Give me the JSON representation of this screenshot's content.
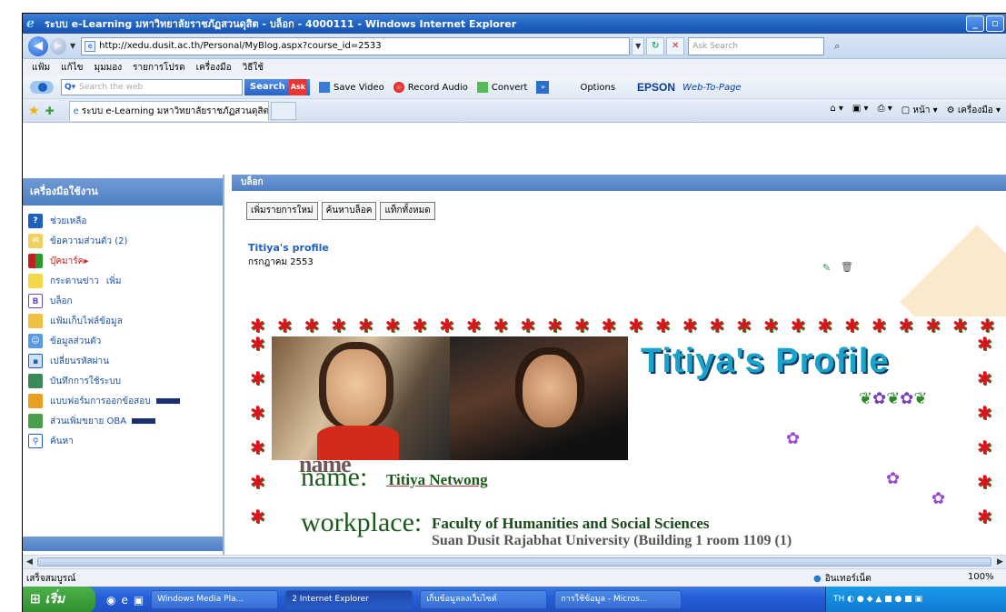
{
  "window": {
    "title": "ระบบ e-Learning มหาวิทยาลัยราชภัฏสวนดุสิต - บล็อก - 4000111 - Windows Internet Explorer"
  },
  "address": {
    "url": "http://xedu.dusit.ac.th/Personal/MyBlog.aspx?course_id=2533",
    "search_placeholder": "Ask Search"
  },
  "menu": {
    "items": [
      "แฟ้ม",
      "แก้ไข",
      "มุมมอง",
      "รายการโปรด",
      "เครื่องมือ",
      "วิธีใช้"
    ]
  },
  "toolbar": {
    "search_placeholder": "Search the web",
    "search_label": "Search",
    "ask_badge": "Ask",
    "save_video": "Save Video",
    "record_audio": "Record Audio",
    "convert": "Convert",
    "options": "Options",
    "epson": "EPSON",
    "web_to_page": "Web-To-Page"
  },
  "tabs": {
    "active_label": "ระบบ e-Learning มหาวิทยาลัยราชภัฏสวนดุสิต - บล็อก - ...",
    "home_label": "หน้า",
    "tools_label": "เครื่องมือ"
  },
  "sidebar": {
    "title": "เครื่องมือใช้งาน",
    "items": [
      {
        "label": "ช่วยเหลือ",
        "icon": "help-icon"
      },
      {
        "label": "ข้อความส่วนตัว (2)",
        "icon": "mail-icon"
      },
      {
        "label": "บุ๊คมาร์ค",
        "icon": "bookmark-icon"
      },
      {
        "label": "กระดานข่าว",
        "extra": "เพิ่ม",
        "icon": "board-icon"
      },
      {
        "label": "บล็อก",
        "icon": "blog-icon"
      },
      {
        "label": "แฟ้มเก็บไฟล์ข้อมูล",
        "icon": "folder-icon"
      },
      {
        "label": "ข้อมูลส่วนตัว",
        "icon": "profile-icon"
      },
      {
        "label": "เปลี่ยนรหัสผ่าน",
        "icon": "password-icon"
      },
      {
        "label": "บันทึกการใช้ระบบ",
        "icon": "log-icon"
      },
      {
        "label": "แบบฟอร์มการออกข้อสอบ",
        "icon": "form-icon"
      },
      {
        "label": "ส่วนเพิ่มขยาย OBA",
        "icon": "oba-icon"
      },
      {
        "label": "ค้นหา",
        "icon": "search-icon"
      }
    ]
  },
  "main": {
    "section_title": "บล็อก",
    "buttons": [
      "เพิ่มรายการใหม่",
      "ค้นหาบล็อค",
      "แท็กทั้งหมด"
    ],
    "post_title": "Titiya's profile",
    "post_date": "กรกฎาคม 2553"
  },
  "profile": {
    "banner_title": "Titiya's Profile",
    "photo_caption": "name",
    "name_label": "name:",
    "name_value": "Titiya  Netwong",
    "work_label": "workplace:",
    "work_value": "Faculty of Humanities and Social Sciences",
    "work_value2": "Suan Dusit Rajabhat University (Building 1 room 1109 (1)"
  },
  "status": {
    "left": "เสร็จสมบูรณ์",
    "zone": "อินเทอร์เน็ต",
    "zoom": "100%"
  },
  "taskbar": {
    "start": "เริ่ม",
    "tasks": [
      "Windows Media Pla...",
      "2 Internet Explorer",
      "เก็บข้อมูลลงเว็บไซต์",
      "การใช้ข้อมูล - Micros..."
    ],
    "lang": "TH"
  }
}
